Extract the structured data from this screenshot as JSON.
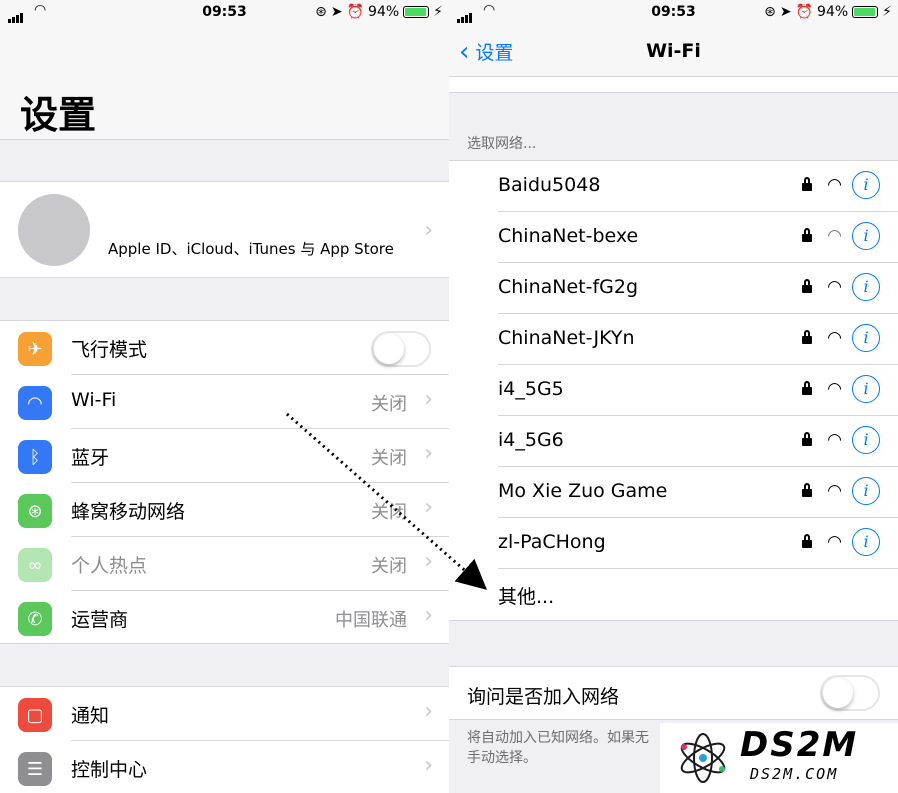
{
  "status": {
    "time": "09:53",
    "battery": "94%",
    "battery_level": 0.94
  },
  "settings": {
    "title": "设置",
    "profile_text": "Apple ID、iCloud、iTunes 与 App Store",
    "rows": [
      {
        "label": "飞行模式",
        "value": "",
        "icon": "airplane-icon",
        "color": "#f7a035"
      },
      {
        "label": "Wi-Fi",
        "value": "关闭",
        "icon": "wifi-icon",
        "color": "#3478f6"
      },
      {
        "label": "蓝牙",
        "value": "关闭",
        "icon": "bluetooth-icon",
        "color": "#3478f6"
      },
      {
        "label": "蜂窝移动网络",
        "value": "关闭",
        "icon": "cellular-icon",
        "color": "#5ac85a"
      },
      {
        "label": "个人热点",
        "value": "关闭",
        "icon": "hotspot-icon",
        "color": "#5ac85a"
      },
      {
        "label": "运营商",
        "value": "中国联通",
        "icon": "phone-icon",
        "color": "#5ac85a"
      }
    ],
    "rows2": [
      {
        "label": "通知",
        "icon": "notification-icon",
        "color": "#ee4b3e"
      },
      {
        "label": "控制中心",
        "icon": "control-center-icon",
        "color": "#8e8e93"
      }
    ]
  },
  "wifi": {
    "back_label": "设置",
    "title": "Wi-Fi",
    "section_header": "选取网络...",
    "networks": [
      {
        "name": "Baidu5048"
      },
      {
        "name": "ChinaNet-bexe"
      },
      {
        "name": "ChinaNet-fG2g"
      },
      {
        "name": "ChinaNet-JKYn"
      },
      {
        "name": "i4_5G5"
      },
      {
        "name": "i4_5G6"
      },
      {
        "name": "Mo Xie Zuo Game"
      },
      {
        "name": "zl-PaCHong"
      }
    ],
    "other_label": "其他...",
    "ask_label": "询问是否加入网络",
    "footnote": "将自动加入已知网络。如果无\n手动选择。"
  },
  "watermark": {
    "brand": "DS2M",
    "url": "DS2M.COM"
  },
  "colors": {
    "accent": "#007aff"
  }
}
